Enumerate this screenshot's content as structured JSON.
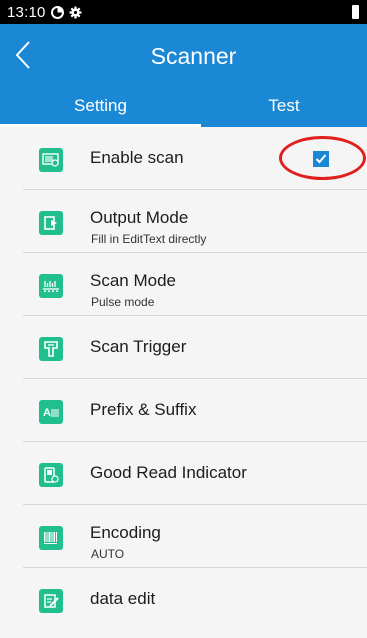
{
  "status_bar": {
    "time": "13:10"
  },
  "app_bar": {
    "title": "Scanner"
  },
  "tabs": [
    {
      "label": "Setting",
      "selected": true
    },
    {
      "label": "Test",
      "selected": false
    }
  ],
  "settings": [
    {
      "title": "Enable scan",
      "subtitle": "",
      "icon": "scanner-icon",
      "checked": true
    },
    {
      "title": "Output Mode",
      "subtitle": "Fill in EditText directly",
      "icon": "output-icon"
    },
    {
      "title": "Scan Mode",
      "subtitle": "Pulse mode",
      "icon": "scan-mode-icon"
    },
    {
      "title": "Scan Trigger",
      "subtitle": "",
      "icon": "trigger-icon"
    },
    {
      "title": "Prefix & Suffix",
      "subtitle": "",
      "icon": "prefix-suffix-icon"
    },
    {
      "title": "Good Read Indicator",
      "subtitle": "",
      "icon": "good-read-icon"
    },
    {
      "title": "Encoding",
      "subtitle": "AUTO",
      "icon": "barcode-icon"
    },
    {
      "title": "data edit",
      "subtitle": "",
      "icon": "edit-icon"
    }
  ],
  "colors": {
    "app_bar": "#1a88d4",
    "icon_bg": "#22bf8e",
    "checkbox": "#1a88d4",
    "highlight_circle": "#e0201c"
  }
}
